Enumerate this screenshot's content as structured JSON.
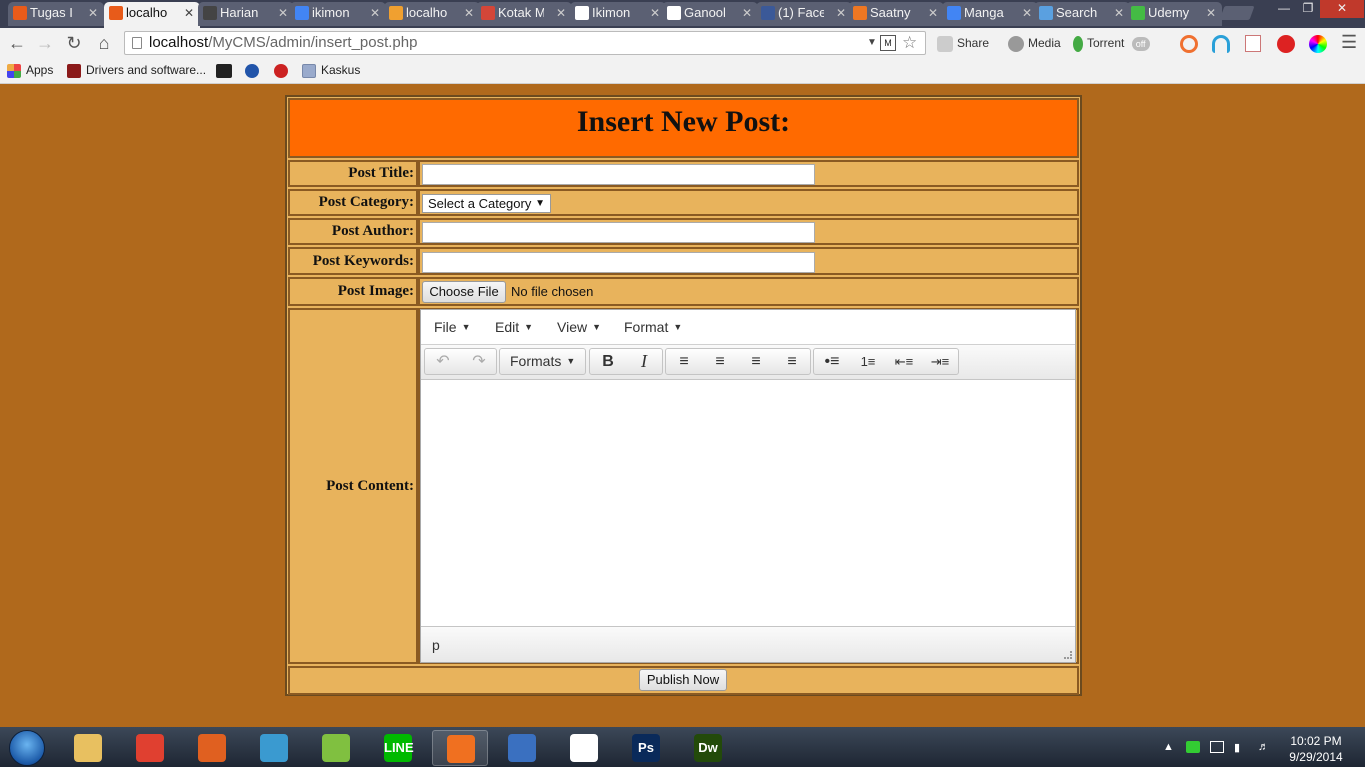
{
  "browser": {
    "tabs": [
      {
        "label": "Tugas I",
        "color": "#e85b1a",
        "active": false
      },
      {
        "label": "localho",
        "color": "#e85b1a",
        "active": true
      },
      {
        "label": "Harian",
        "color": "#444444",
        "active": false
      },
      {
        "label": "ikimon",
        "color": "#4285f4",
        "active": false
      },
      {
        "label": "localho",
        "color": "#f0a030",
        "active": false
      },
      {
        "label": "Kotak M",
        "color": "#d44638",
        "active": false
      },
      {
        "label": "Ikimon",
        "color": "#ffffff",
        "active": false
      },
      {
        "label": "Ganool",
        "color": "#ffffff",
        "active": false
      },
      {
        "label": "(1) Face",
        "color": "#3b5998",
        "active": false
      },
      {
        "label": "Saatny",
        "color": "#ee7722",
        "active": false
      },
      {
        "label": "Manga",
        "color": "#4285f4",
        "active": false
      },
      {
        "label": "Search",
        "color": "#5aa0e0",
        "active": false
      },
      {
        "label": "Udemy",
        "color": "#44bb44",
        "active": false
      }
    ],
    "url_host": "localhost",
    "url_path": "/MyCMS/admin/insert_post.php",
    "extensions": {
      "share": "Share",
      "media": "Media",
      "torrent": "Torrent",
      "torrent_toggle": "off"
    },
    "bookmarks": {
      "apps": "Apps",
      "drivers": "Drivers and software...",
      "kaskus": "Kaskus"
    }
  },
  "form": {
    "heading": "Insert New Post:",
    "labels": {
      "title": "Post Title:",
      "category": "Post Category:",
      "author": "Post Author:",
      "keywords": "Post Keywords:",
      "image": "Post Image:",
      "content": "Post Content:"
    },
    "category_selected": "Select a Category",
    "file_button": "Choose File",
    "file_status": "No file chosen",
    "editor": {
      "menus": [
        "File",
        "Edit",
        "View",
        "Format"
      ],
      "formats_label": "Formats",
      "status_path": "p"
    },
    "publish_label": "Publish Now"
  },
  "taskbar": {
    "time": "10:02 PM",
    "date": "9/29/2014",
    "apps": [
      {
        "icon": "file-explorer-icon",
        "glyph": "",
        "color": "#e8c060"
      },
      {
        "icon": "chrome-icon",
        "glyph": "",
        "color": "#e04030"
      },
      {
        "icon": "firefox-icon",
        "glyph": "",
        "color": "#e06020"
      },
      {
        "icon": "media-player-icon",
        "glyph": "",
        "color": "#3a9ad0"
      },
      {
        "icon": "notepad-plus-icon",
        "glyph": "",
        "color": "#80c040"
      },
      {
        "icon": "line-icon",
        "glyph": "LINE",
        "color": "#00b900"
      },
      {
        "icon": "xampp-icon",
        "glyph": "",
        "color": "#f07020"
      },
      {
        "icon": "thunderbird-icon",
        "glyph": "",
        "color": "#3a70c0"
      },
      {
        "icon": "app-grid-icon",
        "glyph": "",
        "color": "#ffffff"
      },
      {
        "icon": "photoshop-icon",
        "glyph": "Ps",
        "color": "#0a2a5a"
      },
      {
        "icon": "dreamweaver-icon",
        "glyph": "Dw",
        "color": "#234a0a"
      }
    ]
  }
}
